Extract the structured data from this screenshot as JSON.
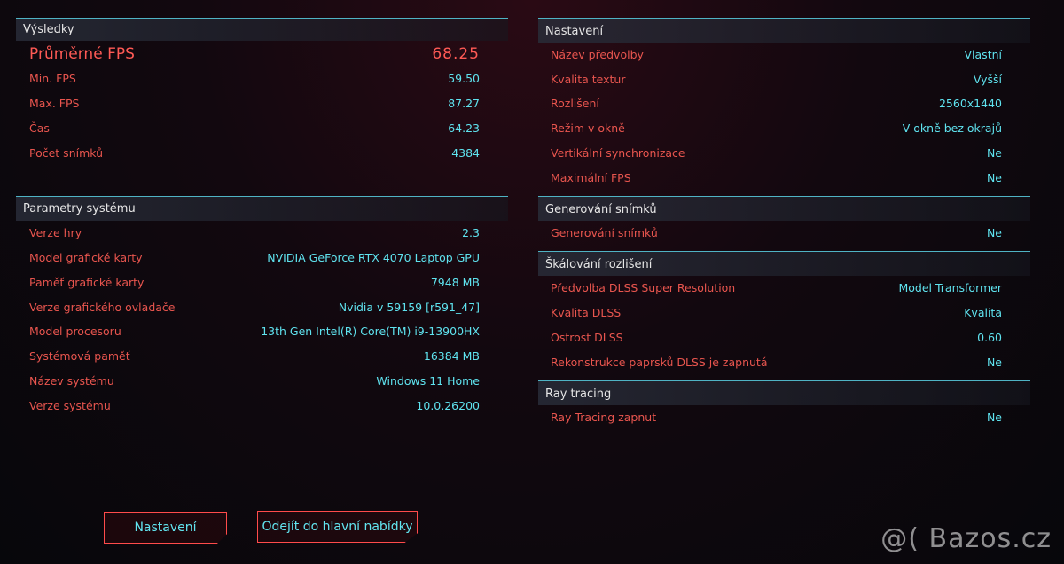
{
  "results": {
    "title": "Výsledky",
    "avg_fps": {
      "label": "Průměrné FPS",
      "value": "68.25"
    },
    "rows": [
      {
        "label": "Min. FPS",
        "value": "59.50"
      },
      {
        "label": "Max. FPS",
        "value": "87.27"
      },
      {
        "label": "Čas",
        "value": "64.23"
      },
      {
        "label": "Počet snímků",
        "value": "4384"
      }
    ]
  },
  "system": {
    "title": "Parametry systému",
    "rows": [
      {
        "label": "Verze hry",
        "value": "2.3"
      },
      {
        "label": "Model grafické karty",
        "value": "NVIDIA GeForce RTX 4070 Laptop GPU"
      },
      {
        "label": "Paměť grafické karty",
        "value": "7948 MB"
      },
      {
        "label": "Verze grafického ovladače",
        "value": "Nvidia v 59159 [r591_47]"
      },
      {
        "label": "Model procesoru",
        "value": "13th Gen Intel(R) Core(TM) i9-13900HX"
      },
      {
        "label": "Systémová paměť",
        "value": "16384 MB"
      },
      {
        "label": "Název systému",
        "value": "Windows 11 Home"
      },
      {
        "label": "Verze systému",
        "value": "10.0.26200"
      }
    ]
  },
  "settings": {
    "title": "Nastavení",
    "rows": [
      {
        "label": "Název předvolby",
        "value": "Vlastní"
      },
      {
        "label": "Kvalita textur",
        "value": "Vyšší"
      },
      {
        "label": "Rozlišení",
        "value": "2560x1440"
      },
      {
        "label": "Režim v okně",
        "value": "V okně bez okrajů"
      },
      {
        "label": "Vertikální synchronizace",
        "value": "Ne"
      },
      {
        "label": "Maximální FPS",
        "value": "Ne"
      }
    ]
  },
  "frame_gen": {
    "title": "Generování snímků",
    "rows": [
      {
        "label": "Generování snímků",
        "value": "Ne"
      }
    ]
  },
  "scaling": {
    "title": "Škálování rozlišení",
    "rows": [
      {
        "label": "Předvolba DLSS Super Resolution",
        "value": "Model Transformer"
      },
      {
        "label": "Kvalita DLSS",
        "value": "Kvalita"
      },
      {
        "label": "Ostrost DLSS",
        "value": "0.60"
      },
      {
        "label": "Rekonstrukce paprsků DLSS je zapnutá",
        "value": "Ne"
      }
    ]
  },
  "ray_tracing": {
    "title": "Ray tracing",
    "rows": [
      {
        "label": "Ray Tracing zapnut",
        "value": "Ne"
      }
    ]
  },
  "buttons": {
    "settings": "Nastavení",
    "main_menu": "Odejít do hlavní nabídky"
  },
  "watermark": "@( Bazos.cz",
  "colors": {
    "label_red": "#e8554e",
    "value_cyan": "#5fe3ef",
    "header_line": "#4fb3c4"
  }
}
